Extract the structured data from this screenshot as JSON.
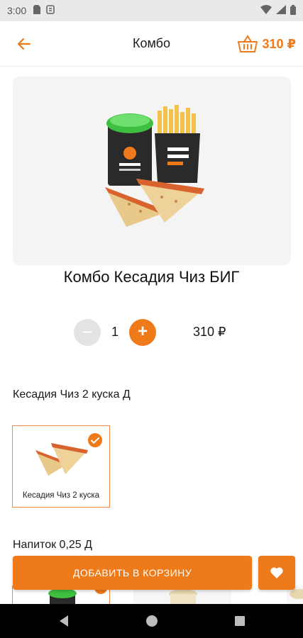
{
  "status_bar": {
    "time": "3:00"
  },
  "header": {
    "title": "Комбо",
    "cart_total": "310 ₽"
  },
  "product": {
    "title": "Комбо Кесадия Чиз БИГ"
  },
  "quantity": {
    "minus": "−",
    "value": "1",
    "plus": "+",
    "price": "310 ₽"
  },
  "sections": [
    {
      "label": "Кесадия Чиз 2 куска Д",
      "options": [
        {
          "caption": "Кесадия Чиз 2 куска",
          "selected": true
        }
      ]
    },
    {
      "label": "Напиток 0,25 Д"
    }
  ],
  "actions": {
    "add_to_cart": "ДОБАВИТЬ В КОРЗИНУ"
  },
  "colors": {
    "accent": "#ef7a1a",
    "selected_border": "#f08a45",
    "minus_disabled": "#e3e3e3"
  }
}
